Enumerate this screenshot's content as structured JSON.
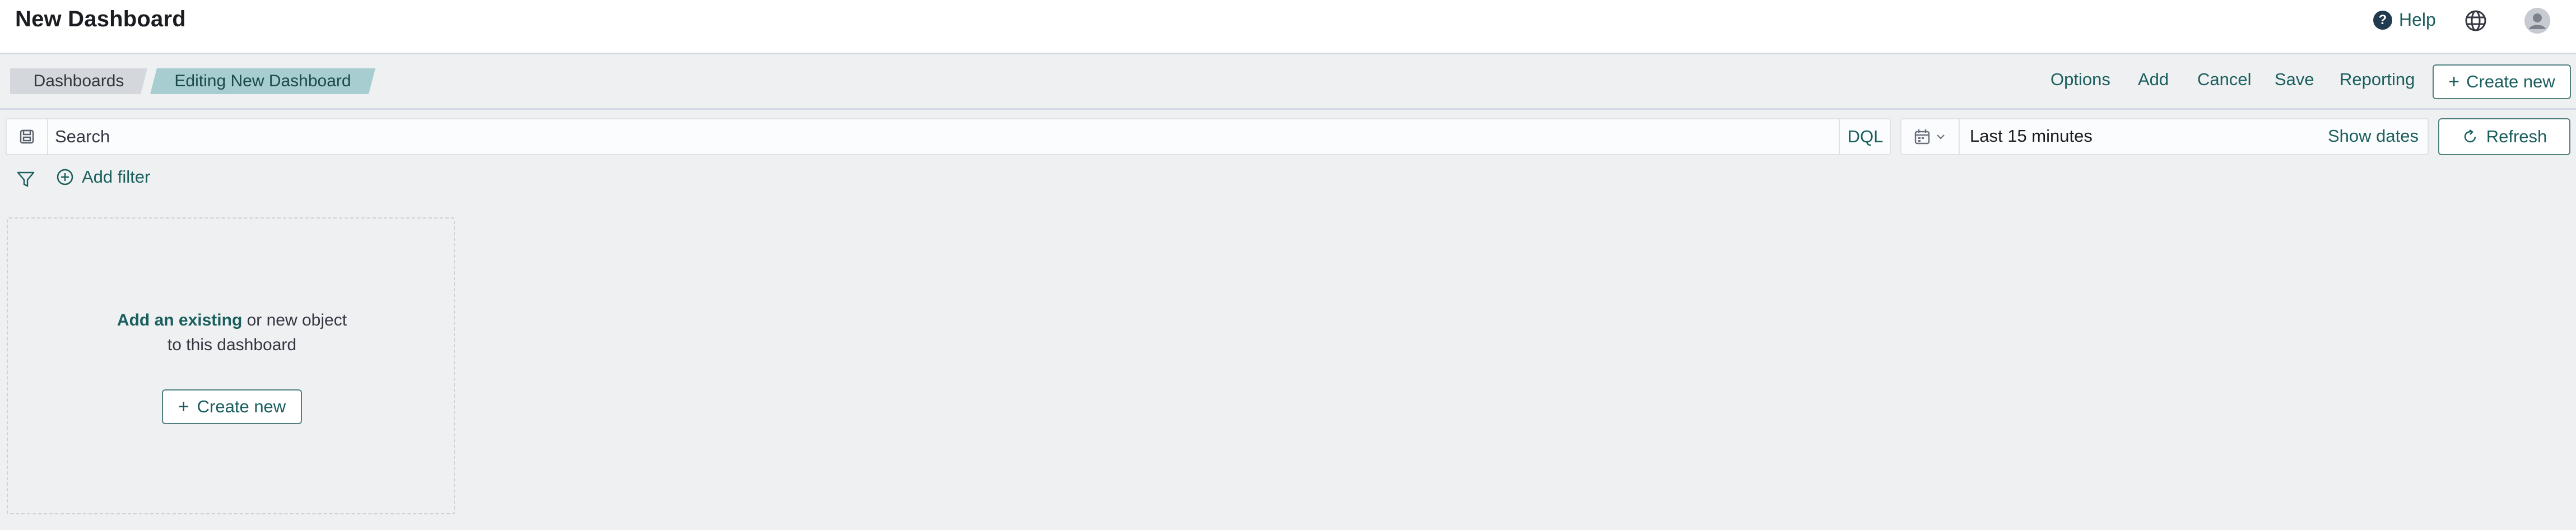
{
  "header": {
    "title": "New Dashboard",
    "help_label": "Help",
    "help_icon_glyph": "?"
  },
  "breadcrumbs": [
    {
      "label": "Dashboards"
    },
    {
      "label": "Editing New Dashboard"
    }
  ],
  "toolbar": {
    "options": "Options",
    "add": "Add",
    "cancel": "Cancel",
    "save": "Save",
    "reporting": "Reporting",
    "create_new": "Create new"
  },
  "query": {
    "placeholder": "Search",
    "language": "DQL"
  },
  "time": {
    "range": "Last 15 minutes",
    "show_dates": "Show dates",
    "refresh": "Refresh"
  },
  "filters": {
    "add_label": "Add filter"
  },
  "empty_panel": {
    "link_text": "Add an existing",
    "rest_text": " or new object to this dashboard",
    "button_label": "Create new"
  },
  "colors": {
    "accent": "#1b5e5e",
    "crumb_inactive": "#d4d8dc",
    "crumb_active": "#a8cdd0",
    "background": "#eef0f1"
  },
  "icons": {
    "help": "help-icon",
    "globe": "globe-icon",
    "avatar": "user-avatar-icon",
    "save_query": "save-query-icon",
    "calendar": "calendar-icon",
    "refresh": "refresh-icon",
    "filter": "filter-icon",
    "add_filter": "plus-circle-icon"
  }
}
